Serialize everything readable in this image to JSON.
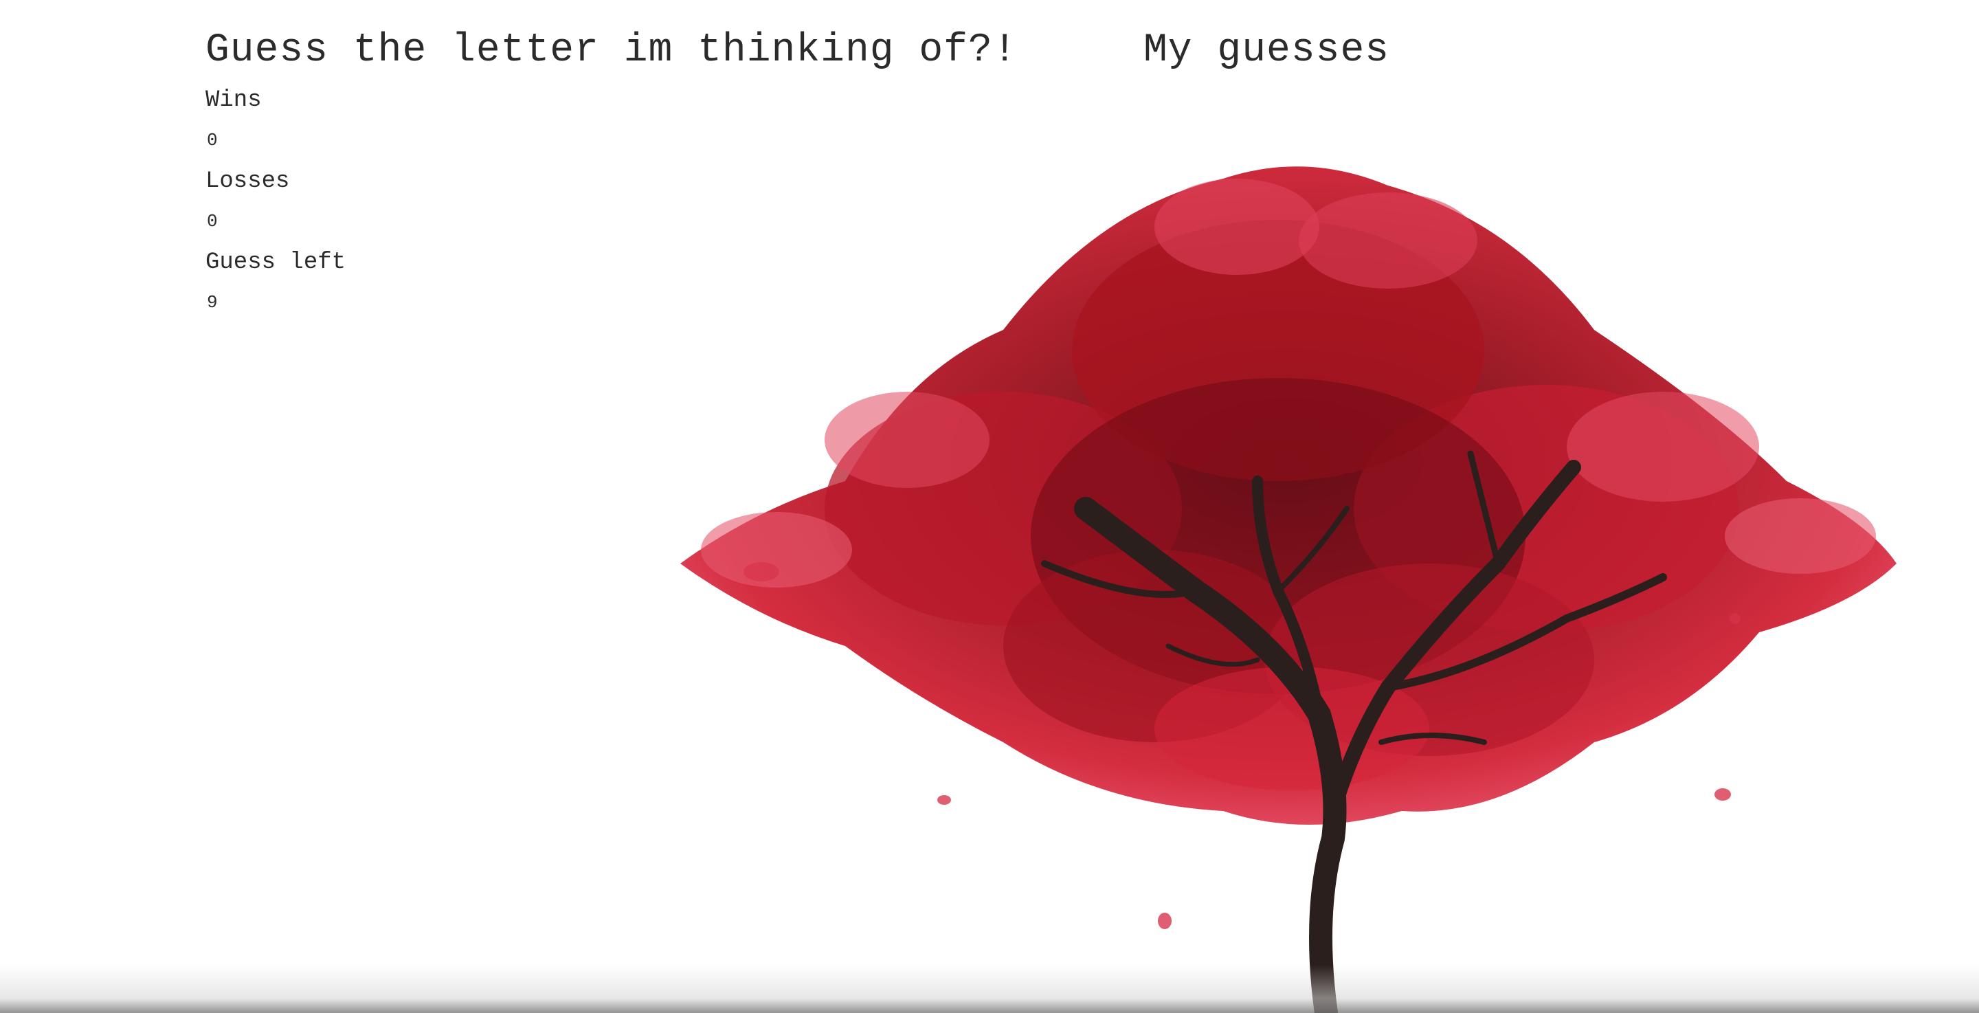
{
  "game": {
    "title": "Guess the letter im thinking of?!",
    "guesses_title": "My guesses",
    "guesses": ""
  },
  "stats": {
    "wins_label": "Wins",
    "wins_value": "0",
    "losses_label": "Losses",
    "losses_value": "0",
    "guess_left_label": "Guess left",
    "guess_left_value": "9"
  },
  "colors": {
    "text": "#2b2b2b",
    "background": "#ffffff",
    "foliage_light": "#e8405a",
    "foliage_mid": "#c8172e",
    "foliage_dark": "#7a0a14",
    "trunk": "#2a1f1c"
  },
  "illustration": "red-tree-illustration"
}
